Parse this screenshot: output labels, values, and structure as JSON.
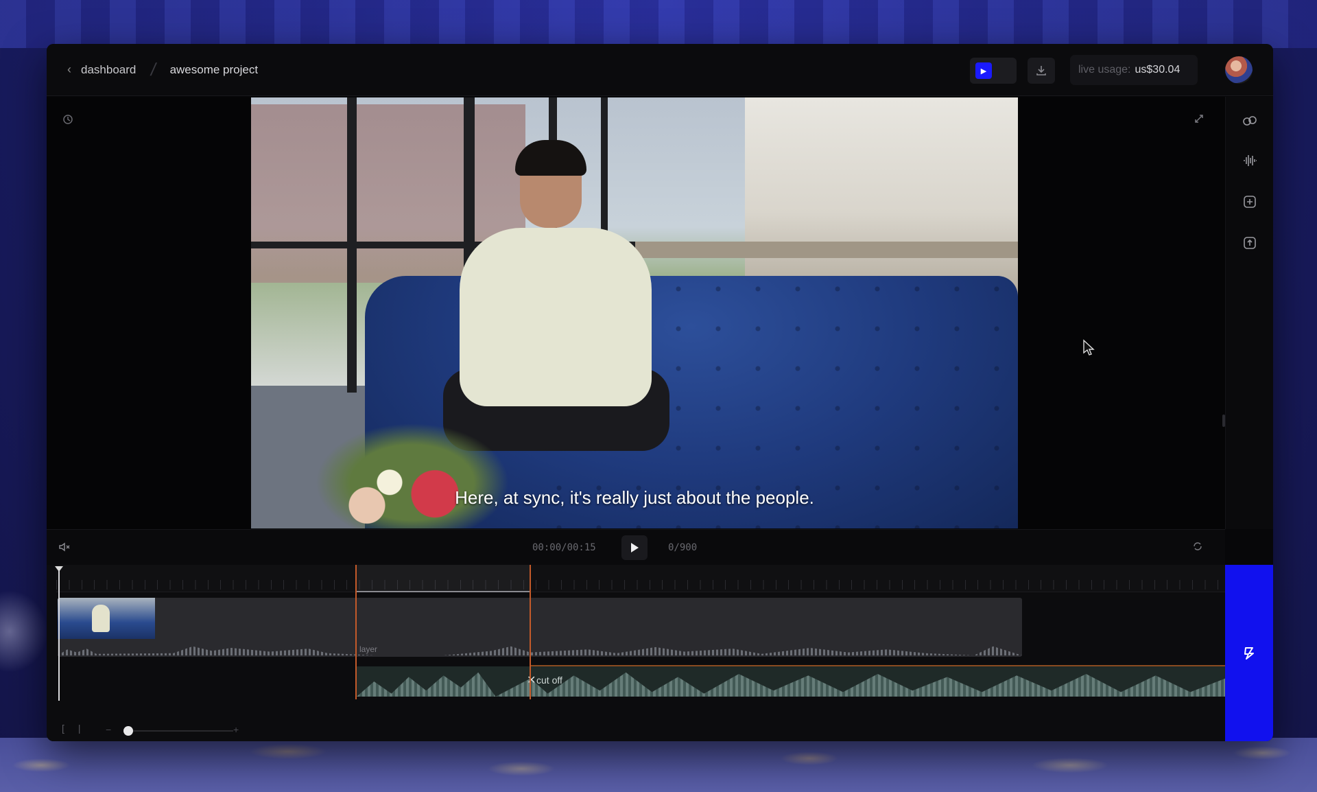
{
  "breadcrumb": {
    "back_icon": "chevron-left-icon",
    "parent": "dashboard",
    "separator": "/",
    "current": "awesome project"
  },
  "header": {
    "play_toggle_icon": "play-icon",
    "download_icon": "download-icon",
    "usage_label": "live usage:",
    "usage_value": "us$30.04"
  },
  "video": {
    "subtitle": "Here, at sync, it's really just about the people."
  },
  "transport": {
    "timecode": "00:00/00:15",
    "frames": "0/900"
  },
  "timeline": {
    "audio_clip_label": "cut off",
    "layer_label": "layer"
  },
  "colors": {
    "accent_blue": "#1111ee",
    "selection_orange": "#c45a2a",
    "window_bg": "#070709"
  }
}
